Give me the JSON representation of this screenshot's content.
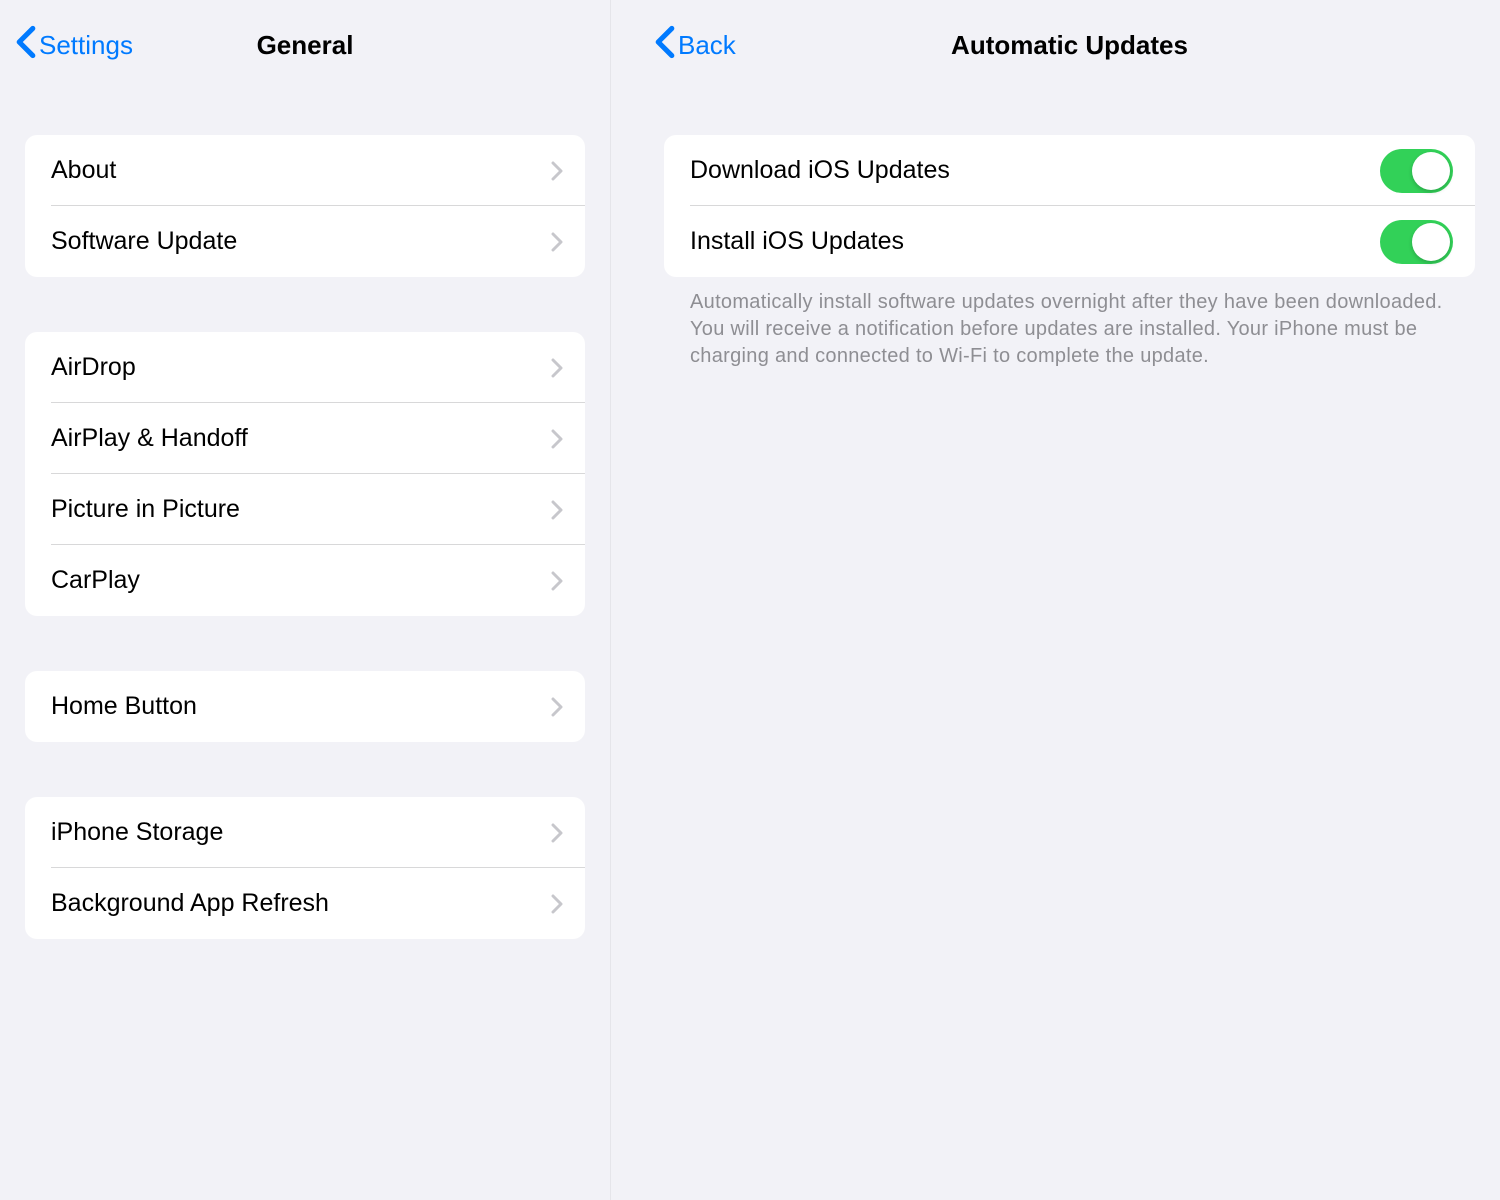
{
  "left": {
    "back_label": "Settings",
    "title": "General",
    "groups": [
      [
        "About",
        "Software Update"
      ],
      [
        "AirDrop",
        "AirPlay & Handoff",
        "Picture in Picture",
        "CarPlay"
      ],
      [
        "Home Button"
      ],
      [
        "iPhone Storage",
        "Background App Refresh"
      ]
    ]
  },
  "right": {
    "back_label": "Back",
    "title": "Automatic Updates",
    "toggles": [
      {
        "label": "Download iOS Updates",
        "on": true
      },
      {
        "label": "Install iOS Updates",
        "on": true
      }
    ],
    "footer": "Automatically install software updates overnight after they have been downloaded. You will receive a notification before updates are installed. Your iPhone must be charging and connected to Wi-Fi to complete the update."
  },
  "colors": {
    "accent": "#007aff",
    "toggle_on": "#32d158"
  }
}
